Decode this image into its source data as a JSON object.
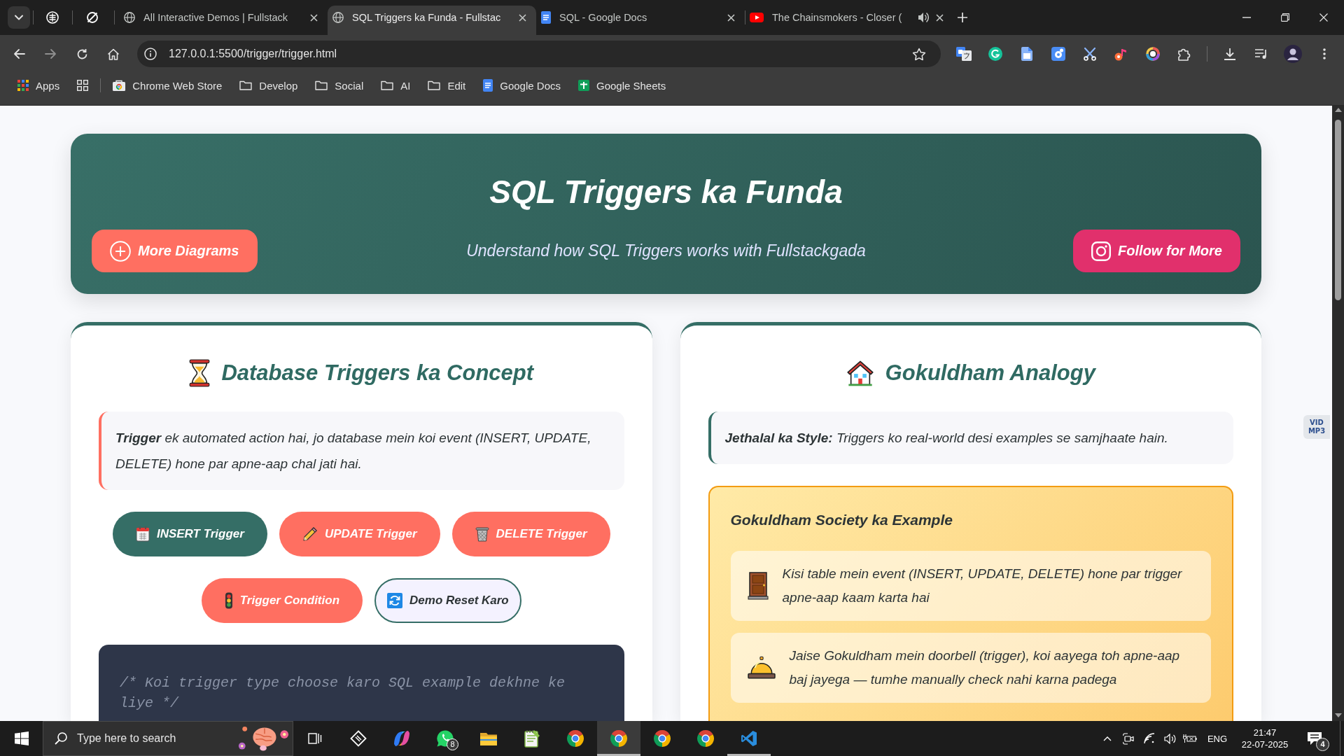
{
  "browser": {
    "tabs": [
      {
        "title": "All Interactive Demos | Fullstack",
        "kind": "globe",
        "selected": false,
        "audible": false
      },
      {
        "title": "SQL Triggers ka Funda - Fullstac",
        "kind": "globe",
        "selected": true,
        "audible": false
      },
      {
        "title": "SQL - Google Docs",
        "kind": "document",
        "selected": false,
        "audible": false
      },
      {
        "title": "The Chainsmokers - Closer (",
        "kind": "video",
        "selected": false,
        "audible": true
      }
    ],
    "address_bar": {
      "url": "127.0.0.1:5500/trigger/trigger.html"
    },
    "apps_shortcut": {
      "label": "Apps"
    },
    "bookmarks": [
      {
        "label": "Chrome Web Store",
        "kind": "store"
      },
      {
        "label": "Develop",
        "kind": "folder"
      },
      {
        "label": "Social",
        "kind": "folder"
      },
      {
        "label": "AI",
        "kind": "folder"
      },
      {
        "label": "Edit",
        "kind": "folder"
      },
      {
        "label": "Google Docs",
        "kind": "document"
      },
      {
        "label": "Google Sheets",
        "kind": "sheet"
      }
    ]
  },
  "page": {
    "header": {
      "title": "SQL Triggers ka Funda",
      "subtitle": "Understand how SQL Triggers works with Fullstackgada",
      "buttons": [
        {
          "label": "More Diagrams",
          "kind": "add"
        },
        {
          "label": "Follow for More",
          "kind": "camera"
        }
      ]
    },
    "cards": [
      {
        "kind": "concept",
        "title": "Database Triggers ka Concept",
        "intro": "**Trigger** ek automated action hai, jo database mein koi event (INSERT, UPDATE, DELETE) hone par apne-aap chal jati hai.",
        "buttons": [
          {
            "label": "INSERT Trigger",
            "kind": "insert",
            "selected": true
          },
          {
            "label": "UPDATE Trigger",
            "kind": "update",
            "selected": false
          },
          {
            "label": "DELETE Trigger",
            "kind": "delete",
            "selected": false
          },
          {
            "label": "Trigger Condition",
            "kind": "condition",
            "selected": false
          },
          {
            "label": "Demo Reset Karo",
            "kind": "reset",
            "selected": false
          }
        ],
        "code": "/* Koi trigger type choose karo SQL example dekhne ke liye */"
      },
      {
        "kind": "analogy",
        "title": "Gokuldham Analogy",
        "intro": "**Jethalal ka Style:** Triggers ko real-world desi examples se samjhaate hain.",
        "example": {
          "title": "Gokuldham Society ka Example",
          "items": [
            {
              "kind": "door",
              "text": "Kisi table mein event (INSERT, UPDATE, DELETE) hone par trigger apne-aap kaam karta hai"
            },
            {
              "kind": "bell",
              "text": "Jaise Gokuldham mein doorbell (trigger), koi aayega toh apne-aap baj jayega — tumhe manually check nahi karna padega"
            }
          ]
        }
      }
    ]
  },
  "side_widget": {
    "label": "VID MP3"
  },
  "taskbar": {
    "search": {
      "placeholder": "Type here to search"
    },
    "apps": [
      {
        "kind": "stylus",
        "selected": false,
        "running": false
      },
      {
        "kind": "swirl",
        "selected": false,
        "running": false
      },
      {
        "kind": "chat",
        "selected": false,
        "running": false,
        "badge": "8"
      },
      {
        "kind": "folder",
        "selected": false,
        "running": false
      },
      {
        "kind": "notepad",
        "selected": false,
        "running": false
      },
      {
        "kind": "browser",
        "selected": false,
        "running": false
      },
      {
        "kind": "browser",
        "selected": true,
        "running": true
      },
      {
        "kind": "browser",
        "selected": false,
        "running": false
      },
      {
        "kind": "browser",
        "selected": false,
        "running": false
      },
      {
        "kind": "code",
        "selected": false,
        "running": true
      }
    ],
    "tray": {
      "language": "ENG",
      "time": "21:47",
      "date": "22-07-2025",
      "notification_count": "4"
    }
  }
}
